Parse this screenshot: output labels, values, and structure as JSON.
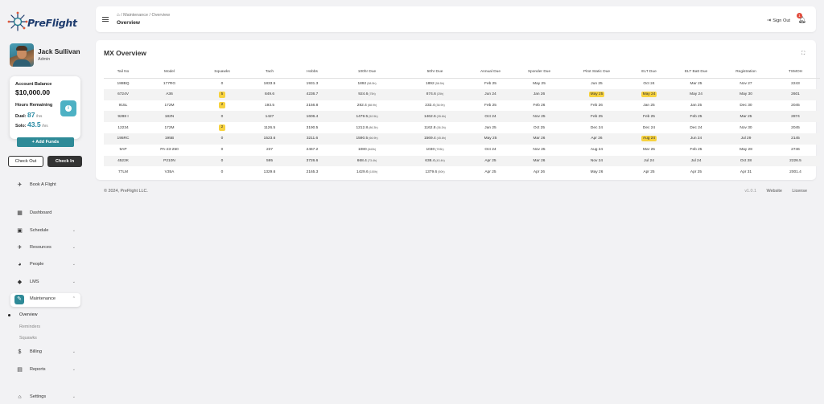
{
  "app": {
    "logo_text": "PreFlight"
  },
  "user": {
    "name": "Jack Sullivan",
    "role": "Admin"
  },
  "account": {
    "balance_label": "Account Balance",
    "balance": "$10,000.00",
    "hours_label": "Hours Remaining",
    "dual_label": "Dual:",
    "dual_value": "87",
    "solo_label": "Solo:",
    "solo_value": "43.5",
    "unit": "hrs",
    "add_funds": "+ Add Funds"
  },
  "actions": {
    "check_out": "Check Out",
    "check_in": "Check In"
  },
  "nav": {
    "book": "Book A Flight",
    "dashboard": "Dashboard",
    "schedule": "Schedule",
    "resources": "Resources",
    "people": "People",
    "lms": "LMS",
    "maintenance": "Maintenance",
    "overview": "Overview",
    "reminders": "Reminders",
    "squawks": "Squawks",
    "billing": "Billing",
    "reports": "Reports",
    "settings": "Settings"
  },
  "header": {
    "breadcrumb": [
      "Maintenance",
      "Overview"
    ],
    "title": "Overview",
    "sign_out": "Sign Out",
    "notification_count": "1"
  },
  "card": {
    "title": "MX Overview"
  },
  "table": {
    "columns": [
      "Tail No",
      "Model",
      "Squawks",
      "Tach",
      "Hobbs",
      "100hr Due",
      "50hr Due",
      "Annual Due",
      "Xponder Due",
      "Pitot Static Due",
      "ELT Due",
      "ELT Batt Due",
      "Registration",
      "TSMOH"
    ],
    "rows": [
      [
        "188BQ",
        "177RG",
        "0",
        "1833.5",
        "1931.3",
        "1892",
        "(58.5h)",
        "1892",
        "(58.5h)",
        "Feb 25",
        "May 25",
        "Jun 25",
        "Oct 24",
        "Mar 25",
        "Nov 27",
        "2243"
      ],
      [
        "6724V",
        "A36",
        "5",
        "849.6",
        "4236.7",
        "924.6",
        "(75h)",
        "874.6",
        "(25h)",
        "Jun 24",
        "Jan 26",
        "May 25",
        "May 24",
        "May 24",
        "May 30",
        "2601"
      ],
      [
        "915L",
        "172M",
        "2",
        "193.5",
        "2156.8",
        "282.4",
        "(88.9h)",
        "232.4",
        "(38.9h)",
        "Feb 25",
        "Feb 26",
        "Feb 26",
        "Jan 25",
        "Jan 25",
        "Dec 30",
        "2045"
      ],
      [
        "9288 I",
        "182N",
        "0",
        "1427",
        "1606.4",
        "1479.5",
        "(52.5h)",
        "1462.6",
        "(35.6h)",
        "Oct 24",
        "Nov 25",
        "Feb 25",
        "Feb 25",
        "Feb 25",
        "Mar 25",
        "2874"
      ],
      [
        "12234",
        "172M",
        "2",
        "1126.5",
        "3190.5",
        "1212.8",
        "(86.3h)",
        "1162.8",
        "(36.3h)",
        "Jan 25",
        "Oct 25",
        "Dec 24",
        "Dec 24",
        "Dec 24",
        "Nov 30",
        "2045"
      ],
      [
        "195RC",
        "195B",
        "0",
        "1523.6",
        "3211.6",
        "1590.5",
        "(66.9h)",
        "1569.4",
        "(45.8h)",
        "May 25",
        "Mar 26",
        "Apr 26",
        "Aug 24",
        "Jun 24",
        "Jul 29",
        "2145"
      ],
      [
        "9AP",
        "PA-23-250",
        "0",
        "237",
        "2467.2",
        "1080",
        "(843h)",
        "1030",
        "(793h)",
        "Oct 24",
        "Nov 25",
        "Aug 24",
        "Mar 25",
        "Feb 25",
        "May 28",
        "2746"
      ],
      [
        "4522K",
        "P210N",
        "0",
        "595",
        "3726.6",
        "668.4",
        "(73.4h)",
        "638.4",
        "(43.4h)",
        "Apr 25",
        "Mar 26",
        "Nov 24",
        "Jul 24",
        "Jul 24",
        "Oct 28",
        "2226.5"
      ],
      [
        "77LM",
        "V35A",
        "0",
        "1329.6",
        "2165.3",
        "1429.6",
        "(100h)",
        "1379.6",
        "(50h)",
        "Apr 25",
        "Apr 26",
        "May 26",
        "Apr 25",
        "Apr 25",
        "Apr 31",
        "2001.4"
      ]
    ]
  },
  "footer": {
    "copyright": "© 2024, PreFlight LLC.",
    "version": "v1.0.1",
    "website": "Website",
    "license": "License"
  },
  "colors": {
    "accent": "#2e8a97",
    "highlight": "#f7d23e",
    "badge": "#e24a3b"
  },
  "icons": [
    "logo-icon",
    "info-icon",
    "plane-icon",
    "dashboard-icon",
    "calendar-icon",
    "airplane-icon",
    "people-icon",
    "graduation-icon",
    "wrench-icon",
    "dollar-icon",
    "reports-icon",
    "settings-icon",
    "home-icon",
    "sign-out-icon",
    "bell-icon",
    "expand-icon",
    "chevron-down-icon",
    "chevron-up-icon"
  ]
}
